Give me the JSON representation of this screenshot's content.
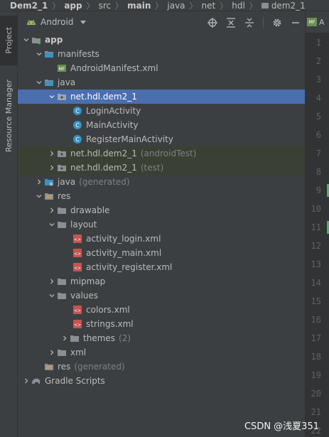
{
  "breadcrumb": [
    "Dem2_1",
    "app",
    "src",
    "main",
    "java",
    "net",
    "hdl",
    "dem2_1"
  ],
  "toolstrip": {
    "project_tab": "Project",
    "resource_tab": "Resource Manager"
  },
  "panel": {
    "view_label": "Android"
  },
  "editor": {
    "tab_label": "A",
    "line_numbers": [
      "1",
      "2",
      "3",
      "4",
      "5",
      "6",
      "7",
      "8",
      "9",
      "10",
      "11",
      "12",
      "13",
      "14",
      "15",
      "16",
      "17",
      "18",
      "19",
      "20",
      "21",
      "22"
    ]
  },
  "tree": [
    {
      "label": "app",
      "bold": true,
      "icon": "module-icon"
    },
    {
      "label": "manifests",
      "icon": "folder-icon"
    },
    {
      "label": "AndroidManifest.xml",
      "icon": "manifest-file-icon"
    },
    {
      "label": "java",
      "icon": "folder-icon"
    },
    {
      "label": "net.hdl.dem2_1",
      "icon": "package-icon"
    },
    {
      "label": "LoginActivity",
      "icon": "class-icon"
    },
    {
      "label": "MainActivity",
      "icon": "class-icon"
    },
    {
      "label": "RegisterMainActivity",
      "icon": "class-icon"
    },
    {
      "label": "net.hdl.dem2_1",
      "suffix": "(androidTest)",
      "icon": "package-icon"
    },
    {
      "label": "net.hdl.dem2_1",
      "suffix": "(test)",
      "icon": "package-icon"
    },
    {
      "label": "java",
      "suffix": "(generated)",
      "icon": "generated-folder-icon"
    },
    {
      "label": "res",
      "icon": "resources-folder-icon"
    },
    {
      "label": "drawable",
      "icon": "folder-icon"
    },
    {
      "label": "layout",
      "icon": "folder-icon"
    },
    {
      "label": "activity_login.xml",
      "icon": "xml-layout-icon"
    },
    {
      "label": "activity_main.xml",
      "icon": "xml-layout-icon"
    },
    {
      "label": "activity_register.xml",
      "icon": "xml-layout-icon"
    },
    {
      "label": "mipmap",
      "icon": "folder-icon"
    },
    {
      "label": "values",
      "icon": "folder-icon"
    },
    {
      "label": "colors.xml",
      "icon": "xml-values-icon"
    },
    {
      "label": "strings.xml",
      "icon": "xml-values-icon"
    },
    {
      "label": "themes",
      "suffix": "(2)",
      "icon": "folder-icon"
    },
    {
      "label": "xml",
      "icon": "folder-icon"
    },
    {
      "label": "res",
      "suffix": "(generated)",
      "icon": "resources-folder-icon"
    },
    {
      "label": "Gradle Scripts",
      "icon": "gradle-icon"
    }
  ],
  "watermark": "CSDN @浅夏351",
  "colors": {
    "selection": "#4b6eaf",
    "test_highlight": "#3a4034",
    "panel_bg": "#3c3f41",
    "class_icon": "#3592c4",
    "xml_icon": "#c75450"
  }
}
